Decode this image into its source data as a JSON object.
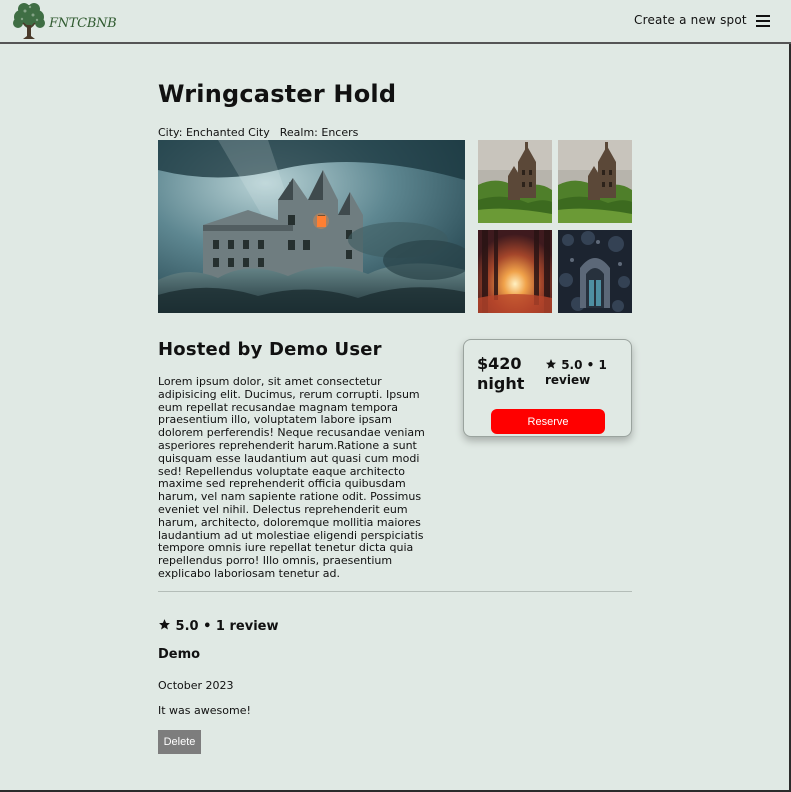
{
  "header": {
    "brand": "FNTCBNB",
    "create_spot_label": "Create a new spot"
  },
  "spot": {
    "name": "Wringcaster Hold",
    "city": "City: Enchanted City",
    "realm": "Realm: Encers",
    "host": "Hosted by Demo User",
    "description": "Lorem ipsum dolor, sit amet consectetur adipisicing elit. Ducimus, rerum corrupti. Ipsum eum repellat recusandae magnam tempora praesentium illo, voluptatem labore ipsam dolorem perferendis! Neque recusandae veniam asperiores reprehenderit harum.Ratione a sunt quisquam esse laudantium aut quasi cum modi sed! Repellendus voluptate eaque architecto maxime sed reprehenderit officia quibusdam harum, vel nam sapiente ratione odit. Possimus eveniet vel nihil. Delectus reprehenderit eum harum, architecto, doloremque mollitia maiores laudantium ad ut molestiae eligendi perspiciatis tempore omnis iure repellat tenetur dicta quia repellendus porro! Illo omnis, praesentium explicabo laboriosam tenetur ad."
  },
  "booking": {
    "price": "$420 night",
    "rating": "5.0 • 1 review",
    "reserve_label": "Reserve"
  },
  "reviews": {
    "summary": "5.0 • 1 review",
    "items": [
      {
        "author": "Demo",
        "date": "October 2023",
        "text": "It was awesome!",
        "delete_label": "Delete"
      }
    ]
  },
  "icons": {
    "logo": "tree-logo-icon",
    "menu": "hamburger-menu-icon",
    "star": "star-icon"
  },
  "colors": {
    "background": "#e0e9e4",
    "reserve_button": "#ff0000",
    "delete_button": "#7d7d7d",
    "brand_text": "#2f5a2f"
  }
}
